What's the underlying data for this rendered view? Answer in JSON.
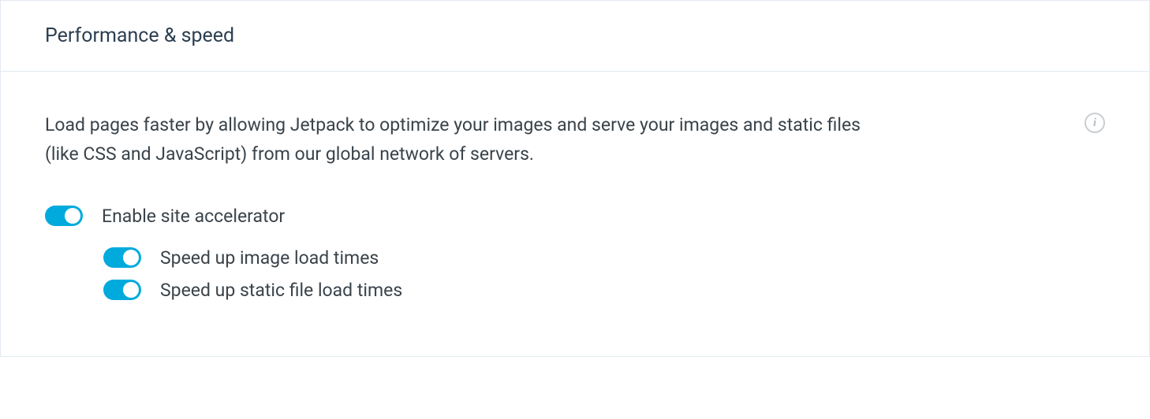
{
  "panel": {
    "title": "Performance & speed",
    "description": "Load pages faster by allowing Jetpack to optimize your images and serve your images and static files (like CSS and JavaScript) from our global network of servers.",
    "info_glyph": "i"
  },
  "toggles": {
    "enable_accelerator": {
      "label": "Enable site accelerator",
      "on": true
    },
    "speed_images": {
      "label": "Speed up image load times",
      "on": true
    },
    "speed_static": {
      "label": "Speed up static file load times",
      "on": true
    }
  }
}
